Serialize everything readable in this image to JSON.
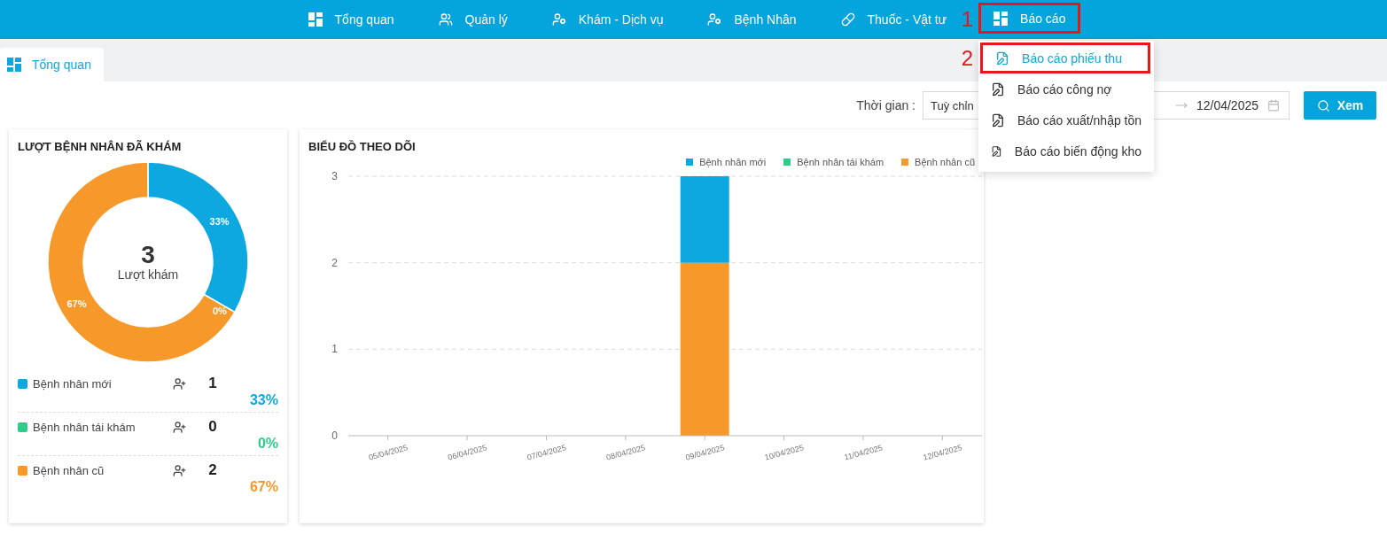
{
  "nav": {
    "items": [
      {
        "label": "Tổng quan"
      },
      {
        "label": "Quản lý"
      },
      {
        "label": "Khám - Dịch vụ"
      },
      {
        "label": "Bệnh Nhân"
      },
      {
        "label": "Thuốc - Vật tư"
      },
      {
        "label": "Báo cáo",
        "annotation": "1",
        "menu": [
          {
            "label": "Báo cáo phiếu thu",
            "selected": true,
            "annotation": "2"
          },
          {
            "label": "Báo cáo công nợ",
            "selected": false
          },
          {
            "label": "Báo cáo xuất/nhập tồn",
            "selected": false
          },
          {
            "label": "Báo cáo biến động kho",
            "selected": false
          }
        ]
      }
    ]
  },
  "tabs": [
    {
      "label": "Tổng quan",
      "selected": true
    }
  ],
  "filter": {
    "label": "Thời gian :",
    "select_value": "Tuỳ chỉn",
    "end_date": "12/04/2025",
    "button": "Xem"
  },
  "visits_card": {
    "title": "LƯỢT BỆNH NHÂN ĐÃ KHÁM",
    "total": "3",
    "total_label": "Lượt khám",
    "groups": [
      {
        "name": "Bệnh nhân mới",
        "color": "#0ea8e0",
        "count": "1",
        "percent": "33%",
        "slice_label": "33%"
      },
      {
        "name": "Bệnh nhân tái khám",
        "color": "#2ecc8a",
        "count": "0",
        "percent": "0%",
        "slice_label": "0%"
      },
      {
        "name": "Bệnh nhân cũ",
        "color": "#f7992a",
        "count": "2",
        "percent": "67%",
        "slice_label": "67%"
      }
    ]
  },
  "chart_card": {
    "title": "BIỂU ĐỒ THEO DÕI",
    "chart_data": {
      "type": "bar",
      "stacked": true,
      "categories": [
        "05/04/2025",
        "06/04/2025",
        "07/04/2025",
        "08/04/2025",
        "09/04/2025",
        "10/04/2025",
        "11/04/2025",
        "12/04/2025"
      ],
      "series": [
        {
          "name": "Bệnh nhân mới",
          "color": "#0ea8e0",
          "values": [
            0,
            0,
            0,
            0,
            1,
            0,
            0,
            0
          ]
        },
        {
          "name": "Bệnh nhân tái khám",
          "color": "#2ecc8a",
          "values": [
            0,
            0,
            0,
            0,
            0,
            0,
            0,
            0
          ]
        },
        {
          "name": "Bệnh nhân cũ",
          "color": "#f7992a",
          "values": [
            0,
            0,
            0,
            0,
            2,
            0,
            0,
            0
          ]
        }
      ],
      "ylim": [
        0,
        3
      ],
      "yticks": [
        0,
        1,
        2,
        3
      ]
    }
  }
}
